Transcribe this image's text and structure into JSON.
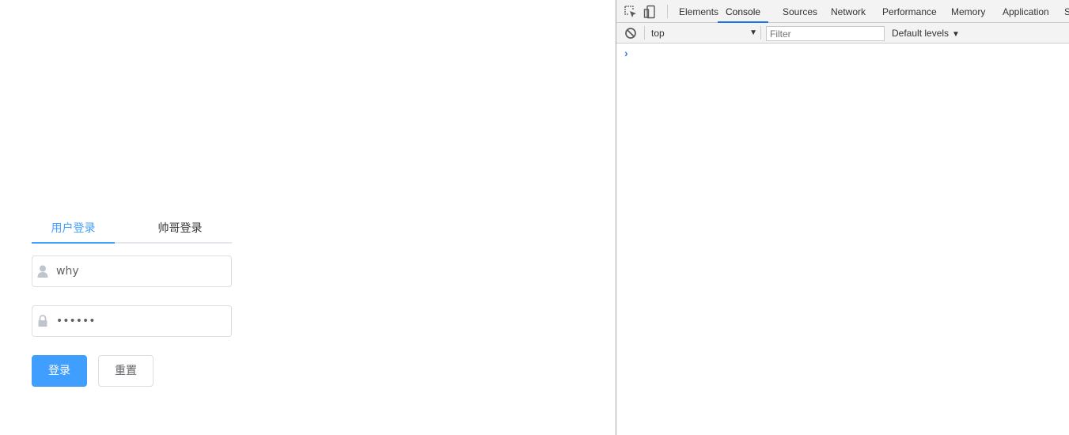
{
  "login": {
    "tabs": [
      {
        "label": "用户登录",
        "active": true
      },
      {
        "label": "帅哥登录",
        "active": false
      }
    ],
    "username": {
      "value": "why",
      "icon": "user-icon"
    },
    "password": {
      "value": "••••••",
      "icon": "lock-icon"
    },
    "buttons": {
      "login": "登录",
      "reset": "重置"
    },
    "accent": "#409eff"
  },
  "devtools": {
    "tabs": [
      "Elements",
      "Console",
      "Sources",
      "Network",
      "Performance",
      "Memory",
      "Application",
      "S"
    ],
    "active_tab": "Console",
    "console": {
      "context": "top",
      "filter_placeholder": "Filter",
      "levels": "Default levels",
      "prompt": "›"
    }
  }
}
